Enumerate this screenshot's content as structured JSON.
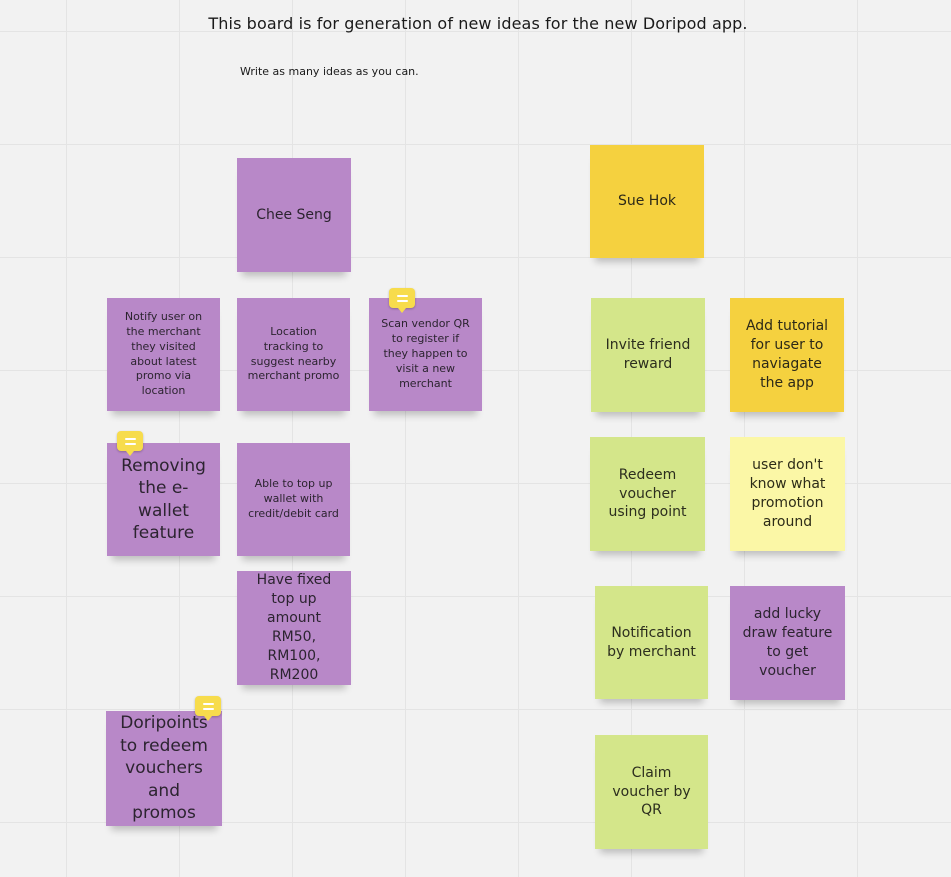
{
  "board": {
    "title": "This board is for generation of new ideas for the new Doripod app.",
    "subtitle": "Write as many ideas as you can."
  },
  "colors": {
    "purple": "#b888c8",
    "green": "#d4e68a",
    "yellow": "#f5d13f",
    "pale_yellow": "#fbf7a6",
    "comment_badge": "#f7dc4c"
  },
  "stickies": {
    "chee_seng": "Chee Seng",
    "notify_user": "Notify user on the merchant they visited about latest promo via location",
    "location_tracking": "Location tracking to suggest nearby merchant promo",
    "scan_vendor_qr": "Scan vendor QR to register if they happen to visit a new merchant",
    "removing_ewallet": "Removing the e-wallet feature",
    "top_up_card": "Able to top up wallet with credit/debit card",
    "fixed_top_up": "Have fixed top up amount RM50, RM100, RM200",
    "doripoints": "Doripoints to redeem vouchers and promos",
    "sue_hok": "Sue Hok",
    "invite_friend": "Invite friend reward",
    "add_tutorial": "Add tutorial for user to naviagate the app",
    "redeem_voucher": "Redeem voucher using point",
    "user_dont_know": "user don't know what promotion around",
    "notification_merchant": "Notification by merchant",
    "lucky_draw": "add lucky draw feature to get voucher",
    "claim_voucher": "Claim voucher by QR"
  },
  "icons": {
    "comment": "comment-icon"
  }
}
